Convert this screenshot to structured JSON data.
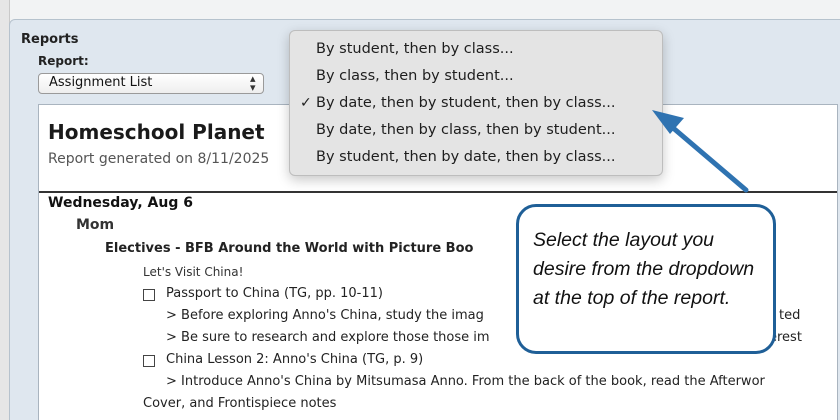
{
  "dialog": {
    "title": "Reports",
    "report_label": "Report:",
    "report_select_value": "Assignment List"
  },
  "layout_dropdown": {
    "items": [
      {
        "label": "By student, then by class...",
        "checked": false
      },
      {
        "label": "By class, then by student...",
        "checked": false
      },
      {
        "label": "By date, then by student, then by class...",
        "checked": true
      },
      {
        "label": "By date, then by class, then by student...",
        "checked": false
      },
      {
        "label": "By student, then by date, then by class...",
        "checked": false
      }
    ],
    "check_glyph": "✓"
  },
  "report": {
    "title": "Homeschool Planet",
    "generated": "Report generated on 8/11/2025",
    "date_heading": "Wednesday, Aug 6",
    "person": "Mom",
    "class_heading": "Electives - BFB Around the World with Picture Boo",
    "unit": "Let's Visit China!",
    "task1": "Passport to China (TG, pp. 10-11)",
    "task1_note1": "> Before exploring Anno's China, study the imag",
    "task1_note1_tail": "ted",
    "task1_note2": "> Be sure to research and explore those those im",
    "task1_note2_tail": "erest",
    "task2": "China Lesson 2: Anno's China (TG, p. 9)",
    "task2_note1": "> Introduce Anno's China by Mitsumasa Anno. From the back of the book, read the Afterwor",
    "task2_note1_cont": "Cover, and Frontispiece notes"
  },
  "callout": {
    "text": "Select the layout you desire from the dropdown at the top of the report."
  },
  "colors": {
    "callout_border": "#1f5f97",
    "arrow": "#2f73b1"
  }
}
